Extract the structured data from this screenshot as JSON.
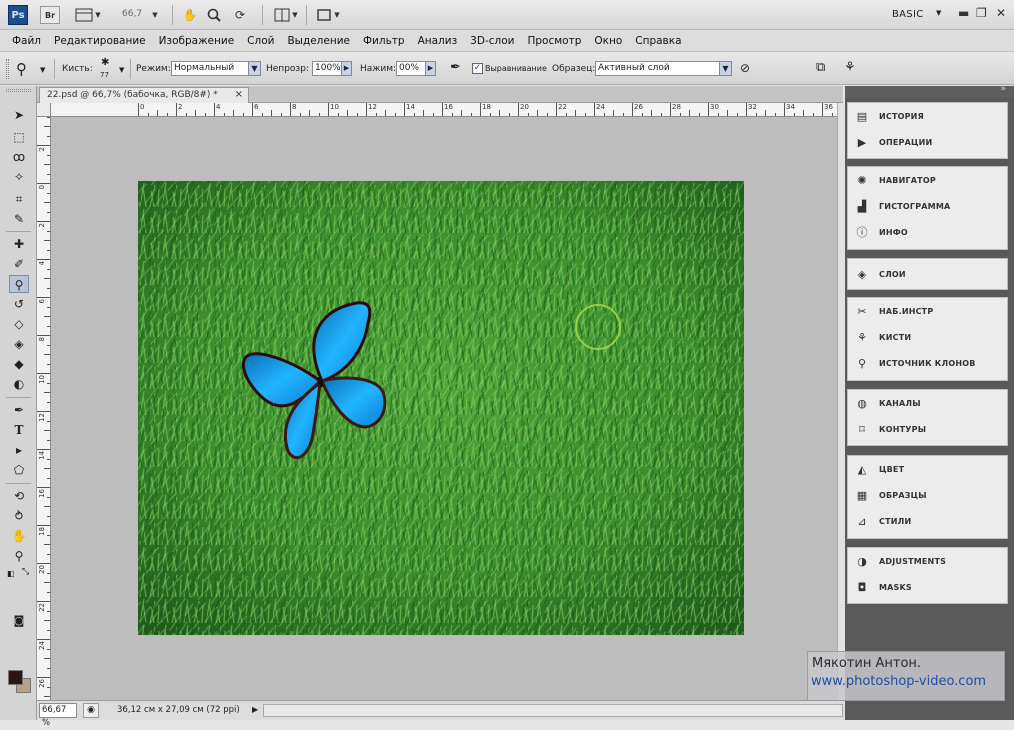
{
  "app_bar": {
    "logo": "Ps",
    "zoom_value": "66,7",
    "workspace": "BASIC",
    "window_controls": [
      "minimize-icon",
      "restore-icon",
      "close-icon"
    ]
  },
  "menu": [
    "Файл",
    "Редактирование",
    "Изображение",
    "Слой",
    "Выделение",
    "Фильтр",
    "Анализ",
    "3D-слои",
    "Просмотр",
    "Окно",
    "Справка"
  ],
  "options": {
    "brush_label": "Кисть:",
    "brush_size": "77",
    "mode_label": "Режим:",
    "mode_value": "Нормальный",
    "opacity_label": "Непрозр:",
    "opacity_value": "100%",
    "flow_label": "Нажим:",
    "flow_value": "00%",
    "aligned_label": "Выравнивание",
    "aligned_checked": true,
    "sample_label": "Образец:",
    "sample_value": "Активный слой"
  },
  "document": {
    "tab_title": "22.psd @ 66,7% (бабочка, RGB/8#) *",
    "tab_close": "×",
    "zoom": "66,67 %",
    "info": "36,12 см x 27,09 см (72 ppi)"
  },
  "ruler": {
    "top": [
      "0",
      "2",
      "4",
      "6",
      "8",
      "10",
      "12",
      "14",
      "16",
      "18",
      "20",
      "22",
      "24",
      "26",
      "28",
      "30",
      "32",
      "34",
      "36",
      "38",
      "40"
    ],
    "left": [
      "4",
      "2",
      "0",
      "2",
      "4",
      "6",
      "8",
      "10",
      "12",
      "14",
      "16",
      "18",
      "20",
      "22",
      "24",
      "26",
      "28",
      "30",
      "32",
      "34"
    ]
  },
  "panels": {
    "collapse_icon": "»",
    "groups": [
      [
        {
          "icon": "history-icon",
          "label": "ИСТОРИЯ"
        },
        {
          "icon": "actions-icon",
          "label": "ОПЕРАЦИИ"
        }
      ],
      [
        {
          "icon": "navigator-icon",
          "label": "НАВИГАТОР"
        },
        {
          "icon": "histogram-icon",
          "label": "ГИСТОГРАММА"
        },
        {
          "icon": "info-icon",
          "label": "ИНФО"
        }
      ],
      [
        {
          "icon": "layers-icon",
          "label": "СЛОИ"
        }
      ],
      [
        {
          "icon": "tool-presets-icon",
          "label": "НАБ.ИНСТР"
        },
        {
          "icon": "brushes-icon",
          "label": "КИСТИ"
        },
        {
          "icon": "clone-source-icon",
          "label": "ИСТОЧНИК КЛОНОВ"
        }
      ],
      [
        {
          "icon": "channels-icon",
          "label": "КАНАЛЫ"
        },
        {
          "icon": "paths-icon",
          "label": "КОНТУРЫ"
        }
      ],
      [
        {
          "icon": "color-icon",
          "label": "ЦВЕТ"
        },
        {
          "icon": "swatches-icon",
          "label": "ОБРАЗЦЫ"
        },
        {
          "icon": "styles-icon",
          "label": "СТИЛИ"
        }
      ],
      [
        {
          "icon": "adjustments-icon",
          "label": "ADJUSTMENTS"
        },
        {
          "icon": "masks-icon",
          "label": "MASKS"
        }
      ]
    ]
  },
  "watermark": {
    "name": "Мякотин Антон.",
    "url": "www.photoshop-video.com"
  },
  "colors": {
    "foreground": "#2a1612",
    "background": "#b8a185",
    "canvas_bg": "#bdbdbd",
    "dock_bg": "#595959"
  }
}
